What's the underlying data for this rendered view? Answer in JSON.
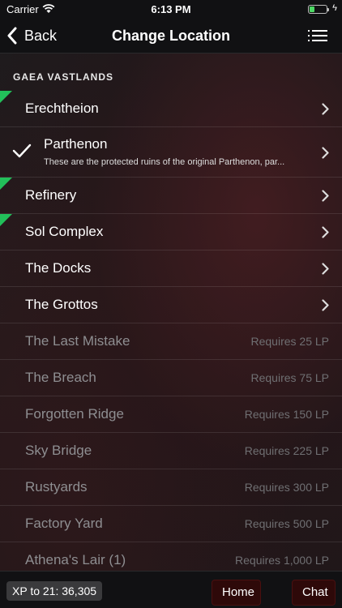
{
  "status_bar": {
    "carrier": "Carrier",
    "time": "6:13 PM"
  },
  "nav": {
    "back_label": "Back",
    "title": "Change Location"
  },
  "section_title": "GAEA VASTLANDS",
  "locations": [
    {
      "name": "Erechtheion",
      "new": true,
      "selected": false
    },
    {
      "name": "Parthenon",
      "new": false,
      "selected": true,
      "description": "These are the protected ruins of the original Parthenon, par..."
    },
    {
      "name": "Refinery",
      "new": true,
      "selected": false
    },
    {
      "name": "Sol Complex",
      "new": true,
      "selected": false
    },
    {
      "name": "The Docks",
      "new": false,
      "selected": false
    },
    {
      "name": "The Grottos",
      "new": false,
      "selected": false
    },
    {
      "name": "The Last Mistake",
      "requirement": "Requires 25 LP"
    },
    {
      "name": "The Breach",
      "requirement": "Requires 75 LP"
    },
    {
      "name": "Forgotten Ridge",
      "requirement": "Requires 150 LP"
    },
    {
      "name": "Sky Bridge",
      "requirement": "Requires 225 LP"
    },
    {
      "name": "Rustyards",
      "requirement": "Requires 300 LP"
    },
    {
      "name": "Factory Yard",
      "requirement": "Requires 500 LP"
    },
    {
      "name": "Athena's Lair (1)",
      "requirement": "Requires 1,000 LP"
    }
  ],
  "bottom_bar": {
    "xp_text": "XP to 21: 36,305",
    "home_label": "Home",
    "chat_label": "Chat"
  },
  "colors": {
    "new_badge": "#22c05a",
    "button_bg": "#2e0909",
    "locked_text": "#8e8e91"
  }
}
